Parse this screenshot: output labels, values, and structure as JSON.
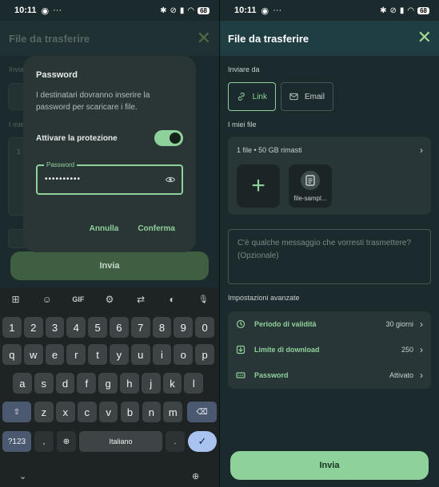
{
  "status_left": {
    "time": "10:11",
    "battery": "68"
  },
  "status_right": {
    "time": "10:11",
    "battery": "68"
  },
  "dialog": {
    "title": "Password",
    "description": "I destinatari dovranno inserire la password per scaricare i file.",
    "protection_label": "Attivare la protezione",
    "protection_on": true,
    "field_label": "Password",
    "field_value": "••••••••••",
    "cancel_label": "Annulla",
    "confirm_label": "Conferma"
  },
  "left_bg": {
    "title": "File da trasferire",
    "frag_1": "Invia",
    "frag_2": "I mie",
    "frag_3": "1",
    "send_label": "Invia"
  },
  "keyboard": {
    "toolbar": [
      "⊞",
      "☺",
      "GIF",
      "⚙",
      "⇄",
      "◐",
      "🎙"
    ],
    "row_numbers": [
      "1",
      "2",
      "3",
      "4",
      "5",
      "6",
      "7",
      "8",
      "9",
      "0"
    ],
    "row_1": [
      "q",
      "w",
      "e",
      "r",
      "t",
      "y",
      "u",
      "i",
      "o",
      "p"
    ],
    "row_2": [
      "a",
      "s",
      "d",
      "f",
      "g",
      "h",
      "j",
      "k",
      "l"
    ],
    "row_3": [
      "z",
      "x",
      "c",
      "v",
      "b",
      "n",
      "m"
    ],
    "shift": "⇧",
    "backspace": "⌫",
    "symbols": "?123",
    "comma": ",",
    "globe": "⊕",
    "space_label": "Italiano",
    "period": ".",
    "enter": "✓",
    "hide": "⌄",
    "lang": "⊕"
  },
  "right": {
    "title": "File da trasferire",
    "send_via_label": "Inviare da",
    "link_label": "Link",
    "email_label": "Email",
    "my_files_label": "I miei file",
    "files_summary": "1 file  •  50 GB rimasti",
    "file_name": "file-sampl...",
    "message_placeholder": "C'è qualche messaggio che vorresti trasmettere? (Opzionale)",
    "advanced_label": "Impostazioni avanzate",
    "settings": [
      {
        "name": "Periodo di validità",
        "value": "30 giorni",
        "icon": "clock-icon"
      },
      {
        "name": "Limite di download",
        "value": "250",
        "icon": "download-icon"
      },
      {
        "name": "Password",
        "value": "Attivato",
        "icon": "password-icon"
      }
    ],
    "send_label": "Invia"
  },
  "colors": {
    "accent": "#8fd19b",
    "background": "#1b2a2c",
    "header": "#1f3e44"
  }
}
